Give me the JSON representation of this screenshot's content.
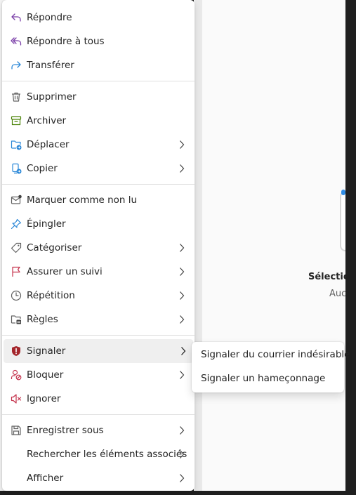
{
  "menu": {
    "items": [
      {
        "key": "reply",
        "label": "Répondre",
        "icon": "reply-icon",
        "color": "#7a3ea8"
      },
      {
        "key": "reply_all",
        "label": "Répondre à tous",
        "icon": "reply-all-icon",
        "color": "#7a3ea8"
      },
      {
        "key": "forward",
        "label": "Transférer",
        "icon": "forward-icon",
        "color": "#2b88d8"
      },
      {
        "key": "delete",
        "label": "Supprimer",
        "icon": "trash-icon",
        "color": "#616161"
      },
      {
        "key": "archive",
        "label": "Archiver",
        "icon": "archive-icon",
        "color": "#498205"
      },
      {
        "key": "move",
        "label": "Déplacer",
        "icon": "folder-move-icon",
        "color": "#2b88d8",
        "submenu": true
      },
      {
        "key": "copy",
        "label": "Copier",
        "icon": "copy-icon",
        "color": "#2b88d8",
        "submenu": true
      },
      {
        "key": "mark_unread",
        "label": "Marquer comme non lu",
        "icon": "mail-unread-icon",
        "color": "#616161"
      },
      {
        "key": "pin",
        "label": "Épingler",
        "icon": "pin-icon",
        "color": "#2b88d8"
      },
      {
        "key": "categorize",
        "label": "Catégoriser",
        "icon": "tag-icon",
        "color": "#616161",
        "submenu": true
      },
      {
        "key": "follow_up",
        "label": "Assurer un suivi",
        "icon": "flag-icon",
        "color": "#c4314b",
        "submenu": true
      },
      {
        "key": "snooze",
        "label": "Répétition",
        "icon": "clock-icon",
        "color": "#616161",
        "submenu": true
      },
      {
        "key": "rules",
        "label": "Règles",
        "icon": "rules-icon",
        "color": "#616161",
        "submenu": true
      },
      {
        "key": "report",
        "label": "Signaler",
        "icon": "shield-report-icon",
        "color": "#a4262c",
        "submenu": true,
        "active": true
      },
      {
        "key": "block",
        "label": "Bloquer",
        "icon": "block-person-icon",
        "color": "#c4314b",
        "submenu": true
      },
      {
        "key": "ignore",
        "label": "Ignorer",
        "icon": "mute-icon",
        "color": "#c4314b"
      },
      {
        "key": "save_as",
        "label": "Enregistrer sous",
        "icon": "save-icon",
        "color": "#616161",
        "submenu": true
      },
      {
        "key": "find_related",
        "label": "Rechercher les éléments associés",
        "icon": "",
        "color": "",
        "submenu": true
      },
      {
        "key": "view",
        "label": "Afficher",
        "icon": "",
        "color": "",
        "submenu": true
      }
    ]
  },
  "submenu": {
    "items": [
      {
        "label": "Signaler du courrier indésirable"
      },
      {
        "label": "Signaler un hameçonnage"
      }
    ]
  },
  "reading_pane": {
    "title": "Sélection",
    "subtitle": "Auc"
  }
}
